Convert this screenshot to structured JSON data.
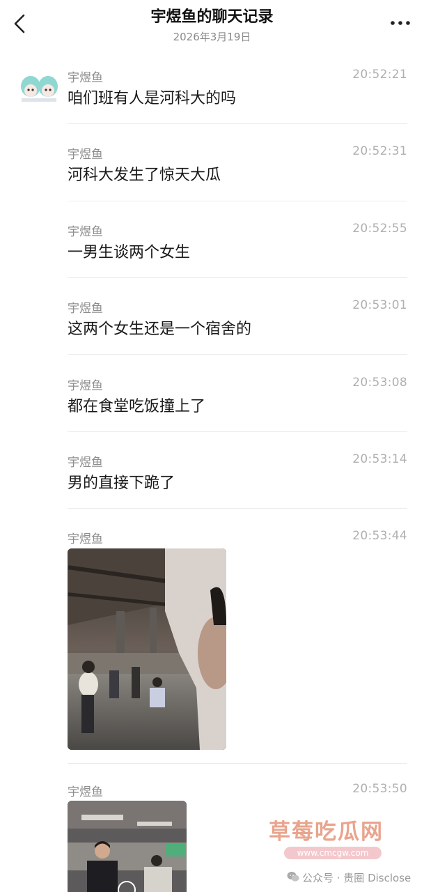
{
  "header": {
    "title": "宇煜鱼的聊天记录",
    "date": "2026年3月19日"
  },
  "messages": [
    {
      "sender": "宇煜鱼",
      "time": "20:52:21",
      "text": "咱们班有人是河科大的吗"
    },
    {
      "sender": "宇煜鱼",
      "time": "20:52:31",
      "text": "河科大发生了惊天大瓜"
    },
    {
      "sender": "宇煜鱼",
      "time": "20:52:55",
      "text": "一男生谈两个女生"
    },
    {
      "sender": "宇煜鱼",
      "time": "20:53:01",
      "text": "这两个女生还是一个宿舍的"
    },
    {
      "sender": "宇煜鱼",
      "time": "20:53:08",
      "text": "都在食堂吃饭撞上了"
    },
    {
      "sender": "宇煜鱼",
      "time": "20:53:14",
      "text": "男的直接下跪了"
    },
    {
      "sender": "宇煜鱼",
      "time": "20:53:44",
      "text": ""
    },
    {
      "sender": "宇煜鱼",
      "time": "20:53:50",
      "text": ""
    }
  ],
  "watermark": {
    "site_name": "草莓吃瓜网",
    "url": "www.cmcgw.com",
    "footer": "公众号 · 贵圈 Disclose"
  },
  "colors": {
    "background": "#ffffff",
    "sender": "#8d8d8d",
    "time": "#b0b0b0",
    "divider": "#ececec",
    "watermark": "#e9a48d"
  },
  "icons": [
    "back-chevron-icon",
    "more-dots-icon",
    "wechat-icon"
  ]
}
